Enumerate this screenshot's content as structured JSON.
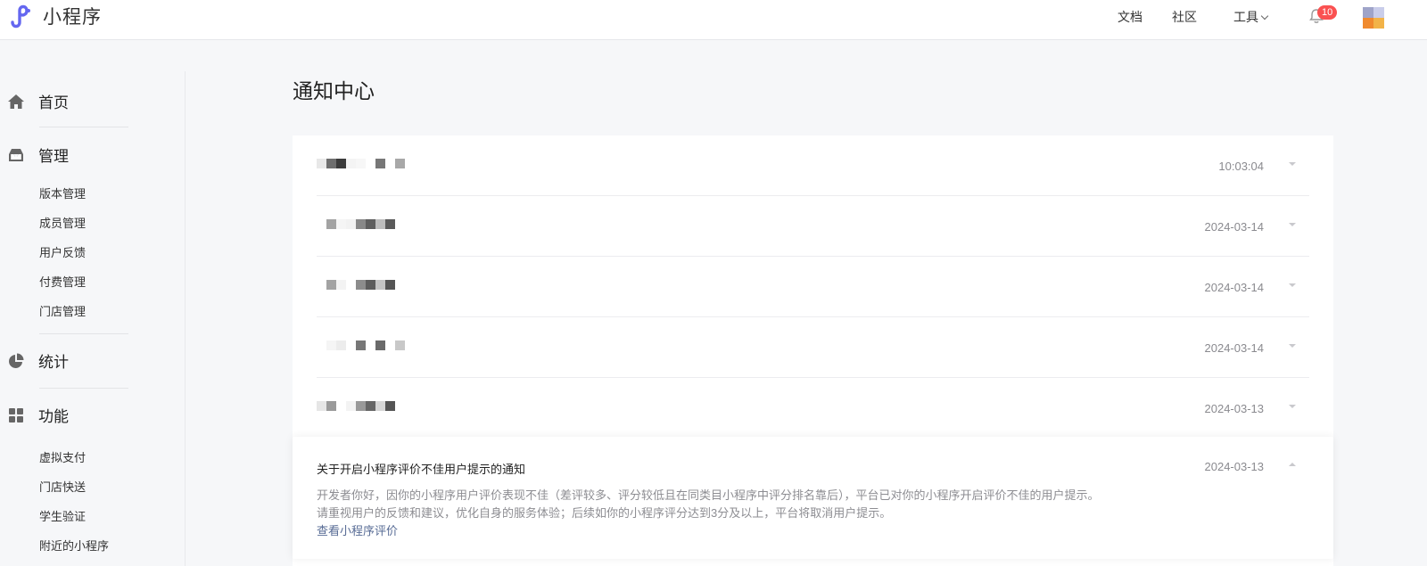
{
  "header": {
    "app_name": "小程序",
    "nav": {
      "docs": "文档",
      "community": "社区",
      "tools": "工具"
    },
    "notification_count": "10",
    "brand_color": "#6467f0"
  },
  "sidebar": {
    "home": "首页",
    "manage": {
      "label": "管理",
      "items": [
        "版本管理",
        "成员管理",
        "用户反馈",
        "付费管理",
        "门店管理"
      ]
    },
    "stats": "统计",
    "features": {
      "label": "功能",
      "items": [
        "虚拟支付",
        "门店快送",
        "学生验证",
        "附近的小程序"
      ]
    }
  },
  "main": {
    "title": "通知中心",
    "notifications": [
      {
        "date": "10:03:04"
      },
      {
        "date": "2024-03-14"
      },
      {
        "date": "2024-03-14"
      },
      {
        "date": "2024-03-14"
      },
      {
        "date": "2024-03-13"
      }
    ],
    "expanded": {
      "title": "关于开启小程序评价不佳用户提示的通知",
      "date": "2024-03-13",
      "body1": "开发者你好，因你的小程序用户评价表现不佳（差评较多、评分较低且在同类目小程序中评分排名靠后），平台已对你的小程序开启评价不佳的用户提示。",
      "body2": "请重视用户的反馈和建议，优化自身的服务体验；后续如你的小程序评分达到3分及以上，平台将取消用户提示。",
      "link": "查看小程序评价"
    }
  }
}
